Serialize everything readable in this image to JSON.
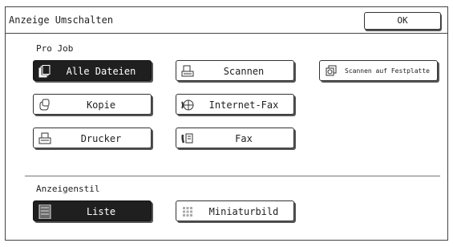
{
  "window": {
    "title": "Anzeige Umschalten",
    "ok_label": "OK"
  },
  "pro_job": {
    "label": "Pro Job",
    "buttons": {
      "alle_dateien": "Alle Dateien",
      "scannen": "Scannen",
      "scannen_festplatte": "Scannen auf Festplatte",
      "kopie": "Kopie",
      "internet_fax": "Internet-Fax",
      "drucker": "Drucker",
      "fax": "Fax"
    },
    "selected": "alle_dateien"
  },
  "anzeigestil": {
    "label": "Anzeigenstil",
    "buttons": {
      "liste": "Liste",
      "miniaturbild": "Miniaturbild"
    },
    "selected": "liste"
  },
  "colors": {
    "selected_bg": "#1f1f1f",
    "border": "#333333",
    "background": "#ffffff"
  }
}
